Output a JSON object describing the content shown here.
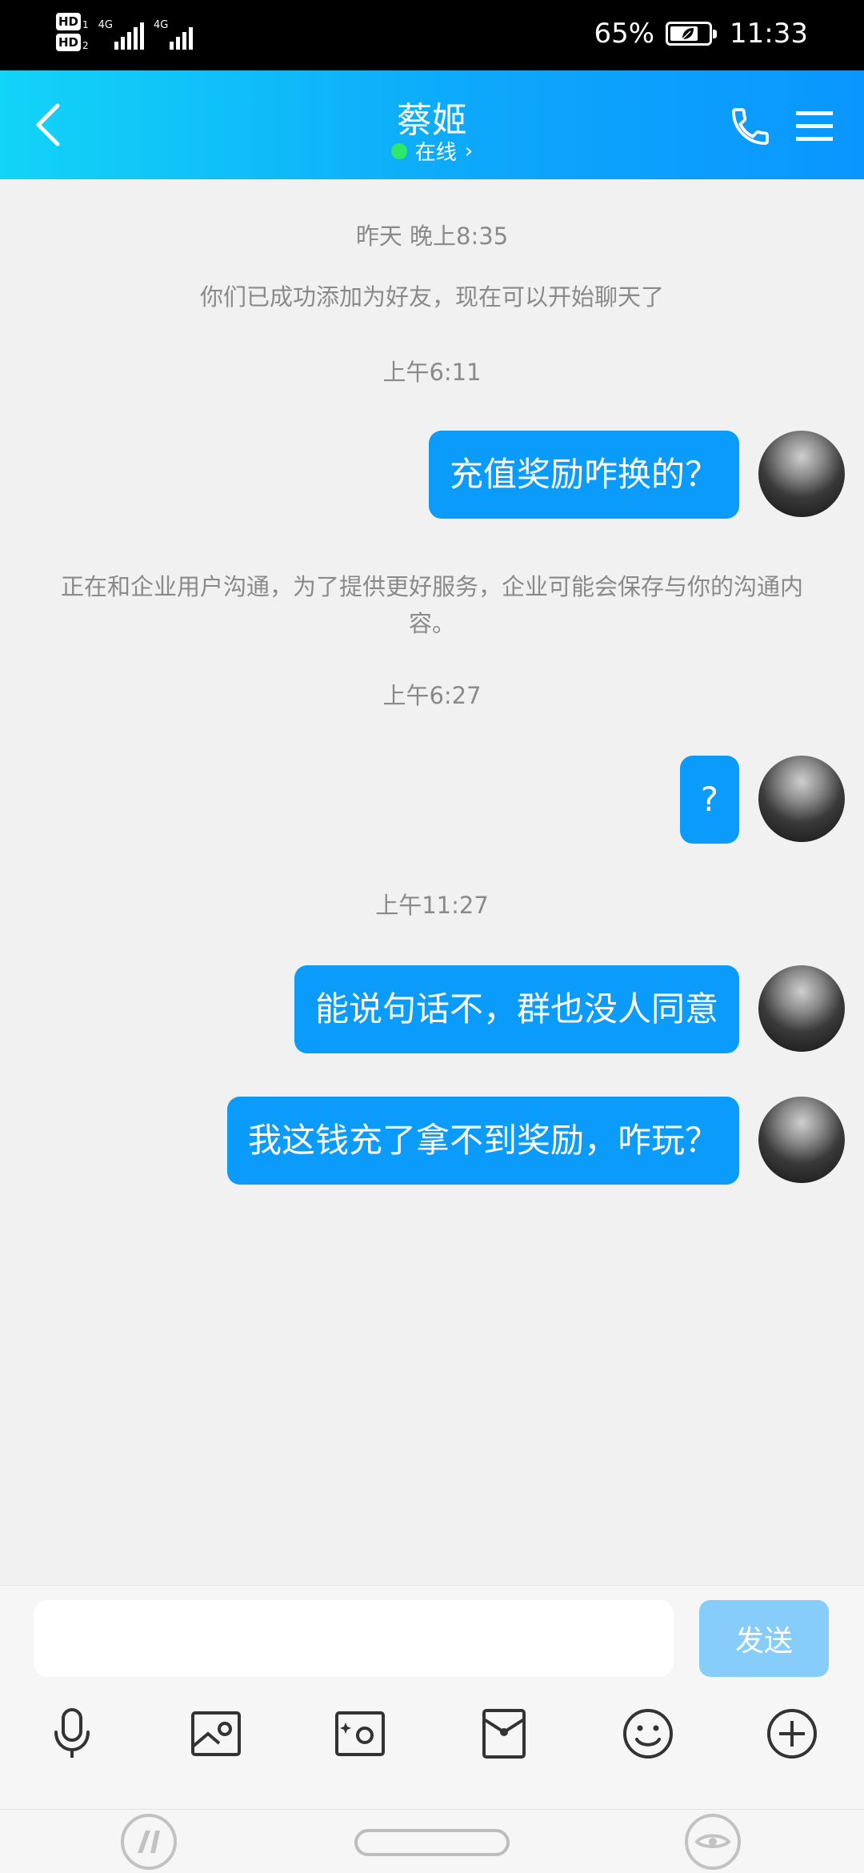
{
  "status_bar": {
    "hd1": "HD",
    "hd1_sub": "1",
    "hd2": "HD",
    "hd2_sub": "2",
    "net1": "4G",
    "net2": "4G",
    "battery_percent": "65%",
    "time": "11:33"
  },
  "header": {
    "title": "蔡姬",
    "status": "在线",
    "status_chevron": "›"
  },
  "messages": [
    {
      "type": "timestamp",
      "text": "昨天 晚上8:35"
    },
    {
      "type": "system",
      "text": "你们已成功添加为好友，现在可以开始聊天了"
    },
    {
      "type": "timestamp",
      "text": "上午6:11"
    },
    {
      "type": "sent",
      "text": "充值奖励咋换的？"
    },
    {
      "type": "system",
      "text": "正在和企业用户沟通，为了提供更好服务，企业可能会保存与你的沟通内容。"
    },
    {
      "type": "timestamp",
      "text": "上午6:27"
    },
    {
      "type": "sent",
      "text": "?"
    },
    {
      "type": "timestamp",
      "text": "上午11:27"
    },
    {
      "type": "sent",
      "text": "能说句话不，群也没人同意"
    },
    {
      "type": "sent",
      "text": "我这钱充了拿不到奖励，咋玩？"
    }
  ],
  "input": {
    "value": "",
    "placeholder": "",
    "send_label": "发送"
  },
  "toolbar": [
    {
      "icon": "microphone-icon"
    },
    {
      "icon": "image-icon"
    },
    {
      "icon": "camera-icon"
    },
    {
      "icon": "red-packet-icon"
    },
    {
      "icon": "emoji-icon"
    },
    {
      "icon": "plus-icon"
    }
  ],
  "colors": {
    "header_gradient_start": "#12d4f7",
    "header_gradient_end": "#0a96ff",
    "bubble": "#0a9bfb",
    "send_button": "#86cdfb",
    "online_dot": "#2ee86a",
    "background": "#f1f1f1"
  }
}
